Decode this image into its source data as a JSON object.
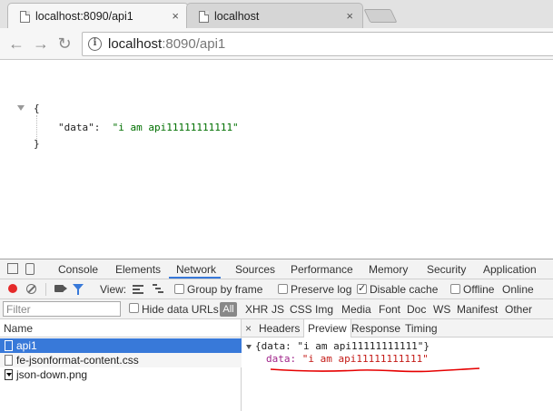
{
  "browser": {
    "tabs": [
      {
        "title": "localhost:8090/api1",
        "active": true
      },
      {
        "title": "localhost",
        "active": false
      }
    ],
    "close_glyph": "×",
    "url_host": "localhost",
    "url_rest": ":8090/api1",
    "nav_icons": [
      "back-arrow-icon",
      "forward-arrow-icon",
      "reload-icon"
    ]
  },
  "page": {
    "open_brace": "{",
    "key": "\"data\":",
    "value": "\"i am api11111111111\"",
    "close_brace": "}"
  },
  "devtools": {
    "tabs": [
      "Console",
      "Elements",
      "Network",
      "Sources",
      "Performance",
      "Memory",
      "Security",
      "Application"
    ],
    "active_tab": "Network",
    "toolbar": {
      "view_label": "View:",
      "group_by_frame": "Group by frame",
      "preserve_log": "Preserve log",
      "disable_cache": "Disable cache",
      "offline": "Offline",
      "online": "Online"
    },
    "filter": {
      "placeholder": "Filter",
      "hide_data_urls": "Hide data URLs",
      "all": "All",
      "types": [
        "XHR",
        "JS",
        "CSS",
        "Img",
        "Media",
        "Font",
        "Doc",
        "WS",
        "Manifest",
        "Other"
      ]
    },
    "requests": {
      "header": "Name",
      "rows": [
        "api1",
        "fe-jsonformat-content.css",
        "json-down.png"
      ]
    },
    "detail": {
      "close": "×",
      "tabs": [
        "Headers",
        "Preview",
        "Response",
        "Timing"
      ],
      "active_tab": "Preview",
      "summary": "{data: \"i am api11111111111\"}",
      "key": "data:",
      "value": "\"i am api11111111111\""
    },
    "colors": {
      "accent": "#3879d9",
      "record": "#e52a2a",
      "annotation": "#e60000"
    }
  }
}
